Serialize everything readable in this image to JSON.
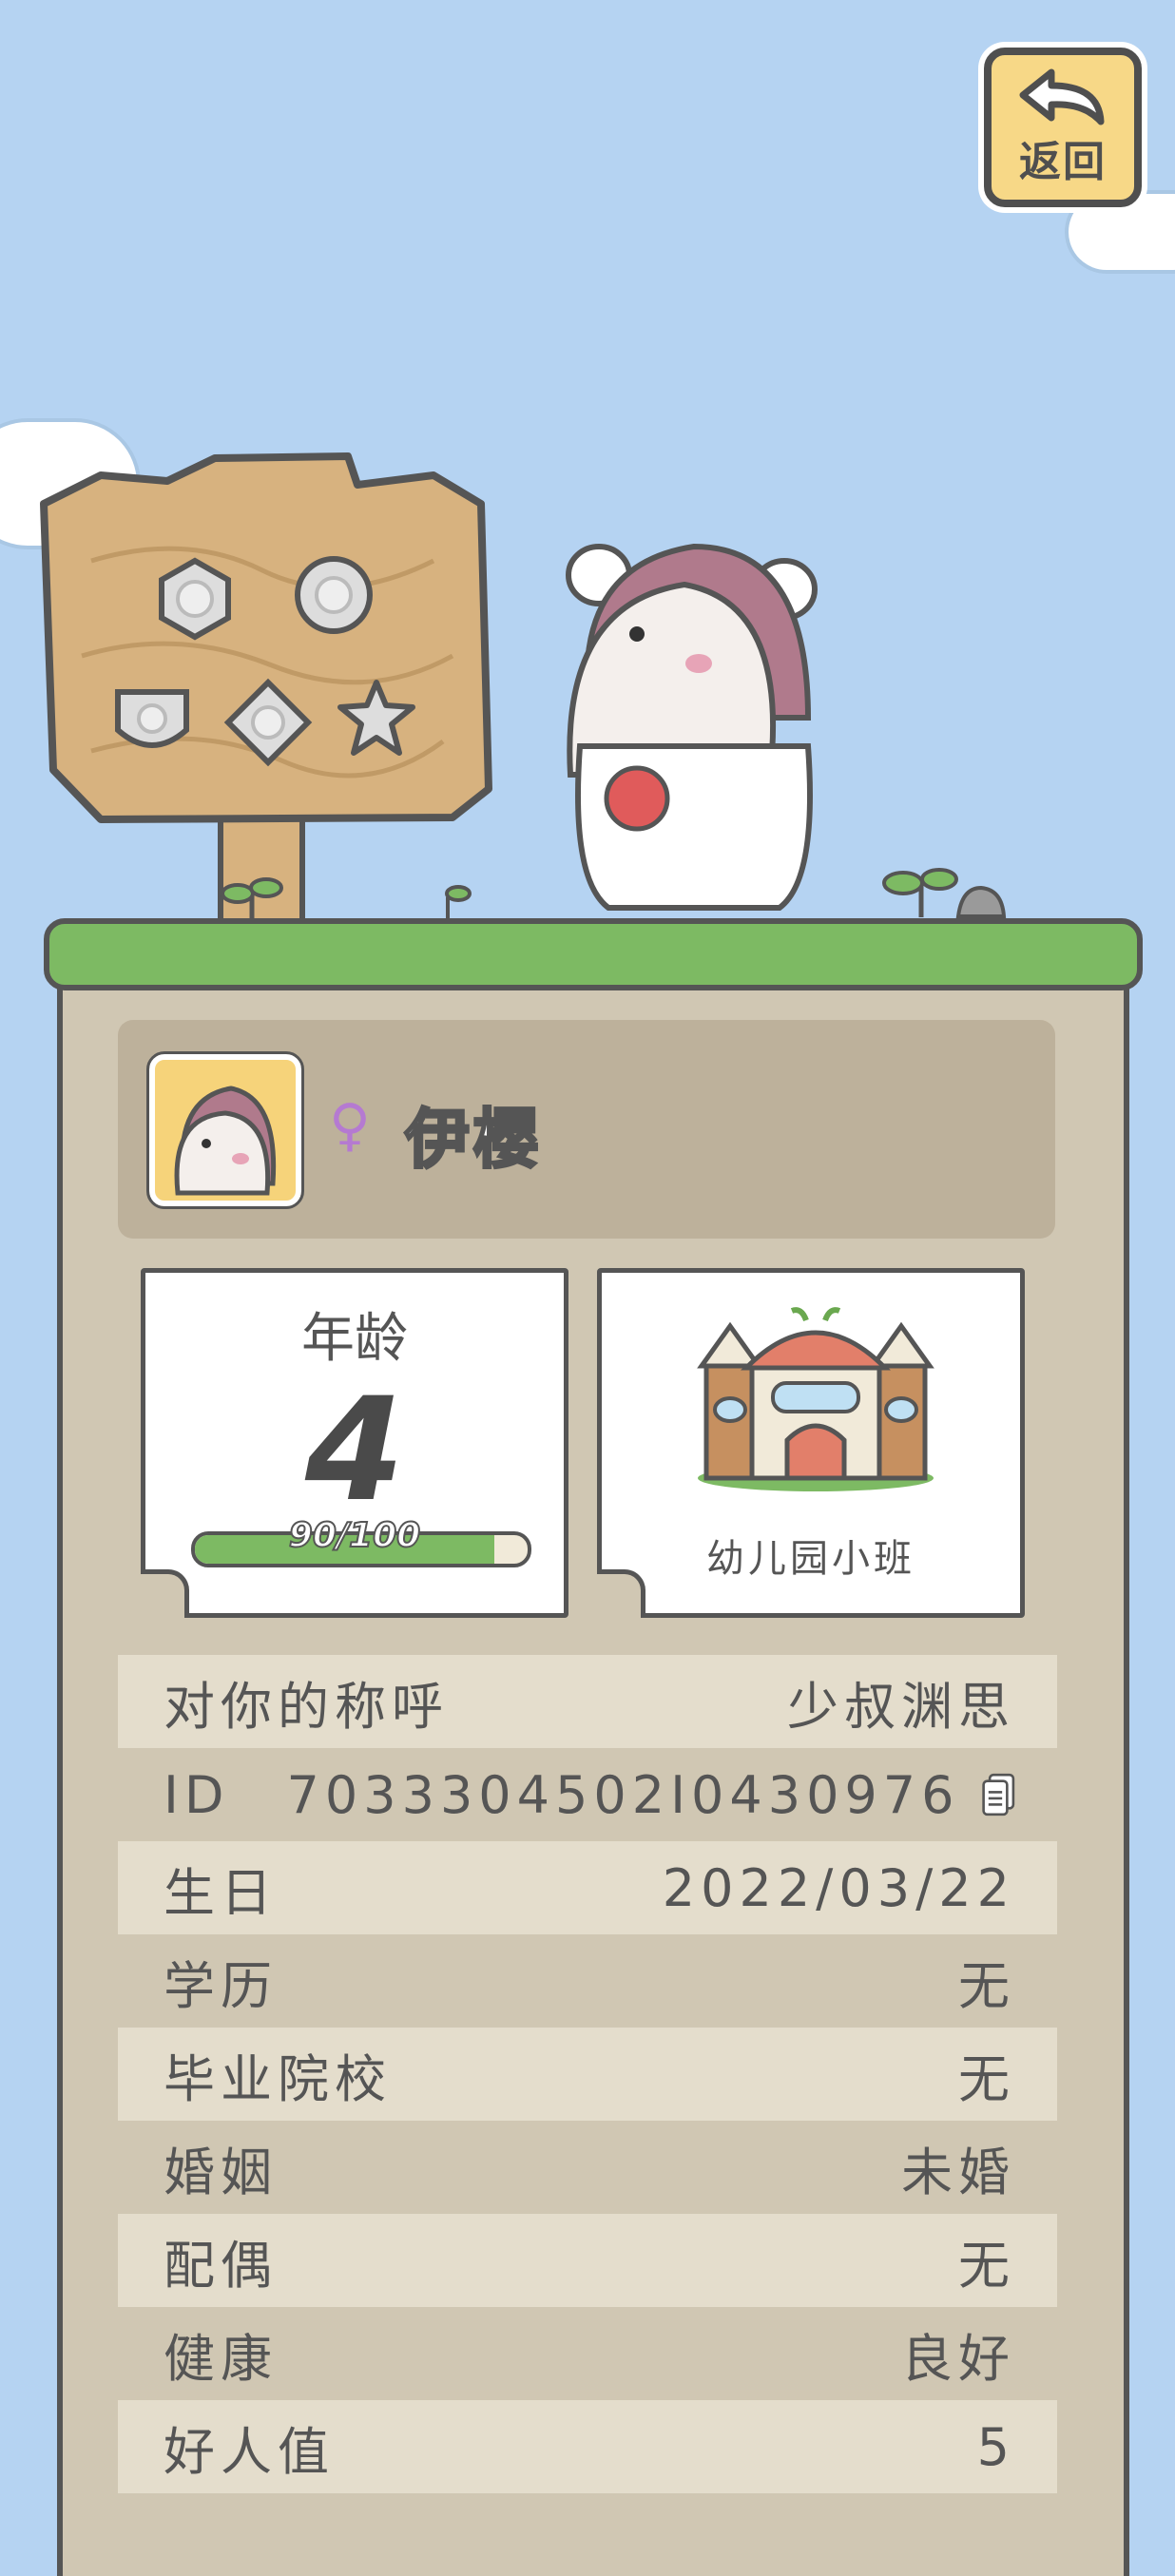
{
  "header": {
    "back_label": "返回"
  },
  "profile": {
    "gender_symbol": "♀",
    "name": "伊樱"
  },
  "age_card": {
    "title": "年龄",
    "value": "4",
    "progress_text": "90/100",
    "progress_fraction": 0.9
  },
  "school_card": {
    "label": "幼儿园小班"
  },
  "info_rows": [
    {
      "label": "对你的称呼",
      "value": "少叔渊思"
    },
    {
      "label": "ID",
      "value": "7033304502I0430976"
    },
    {
      "label": "生日",
      "value": "2022/03/22"
    },
    {
      "label": "学历",
      "value": "无"
    },
    {
      "label": "毕业院校",
      "value": "无"
    },
    {
      "label": "婚姻",
      "value": "未婚"
    },
    {
      "label": "配偶",
      "value": "无"
    },
    {
      "label": "健康",
      "value": "良好"
    },
    {
      "label": "好人值",
      "value": "5"
    }
  ],
  "colors": {
    "sky": "#b5d3f2",
    "grass": "#7dba63",
    "panel": "#d0c7b3",
    "button": "#f7d887"
  }
}
